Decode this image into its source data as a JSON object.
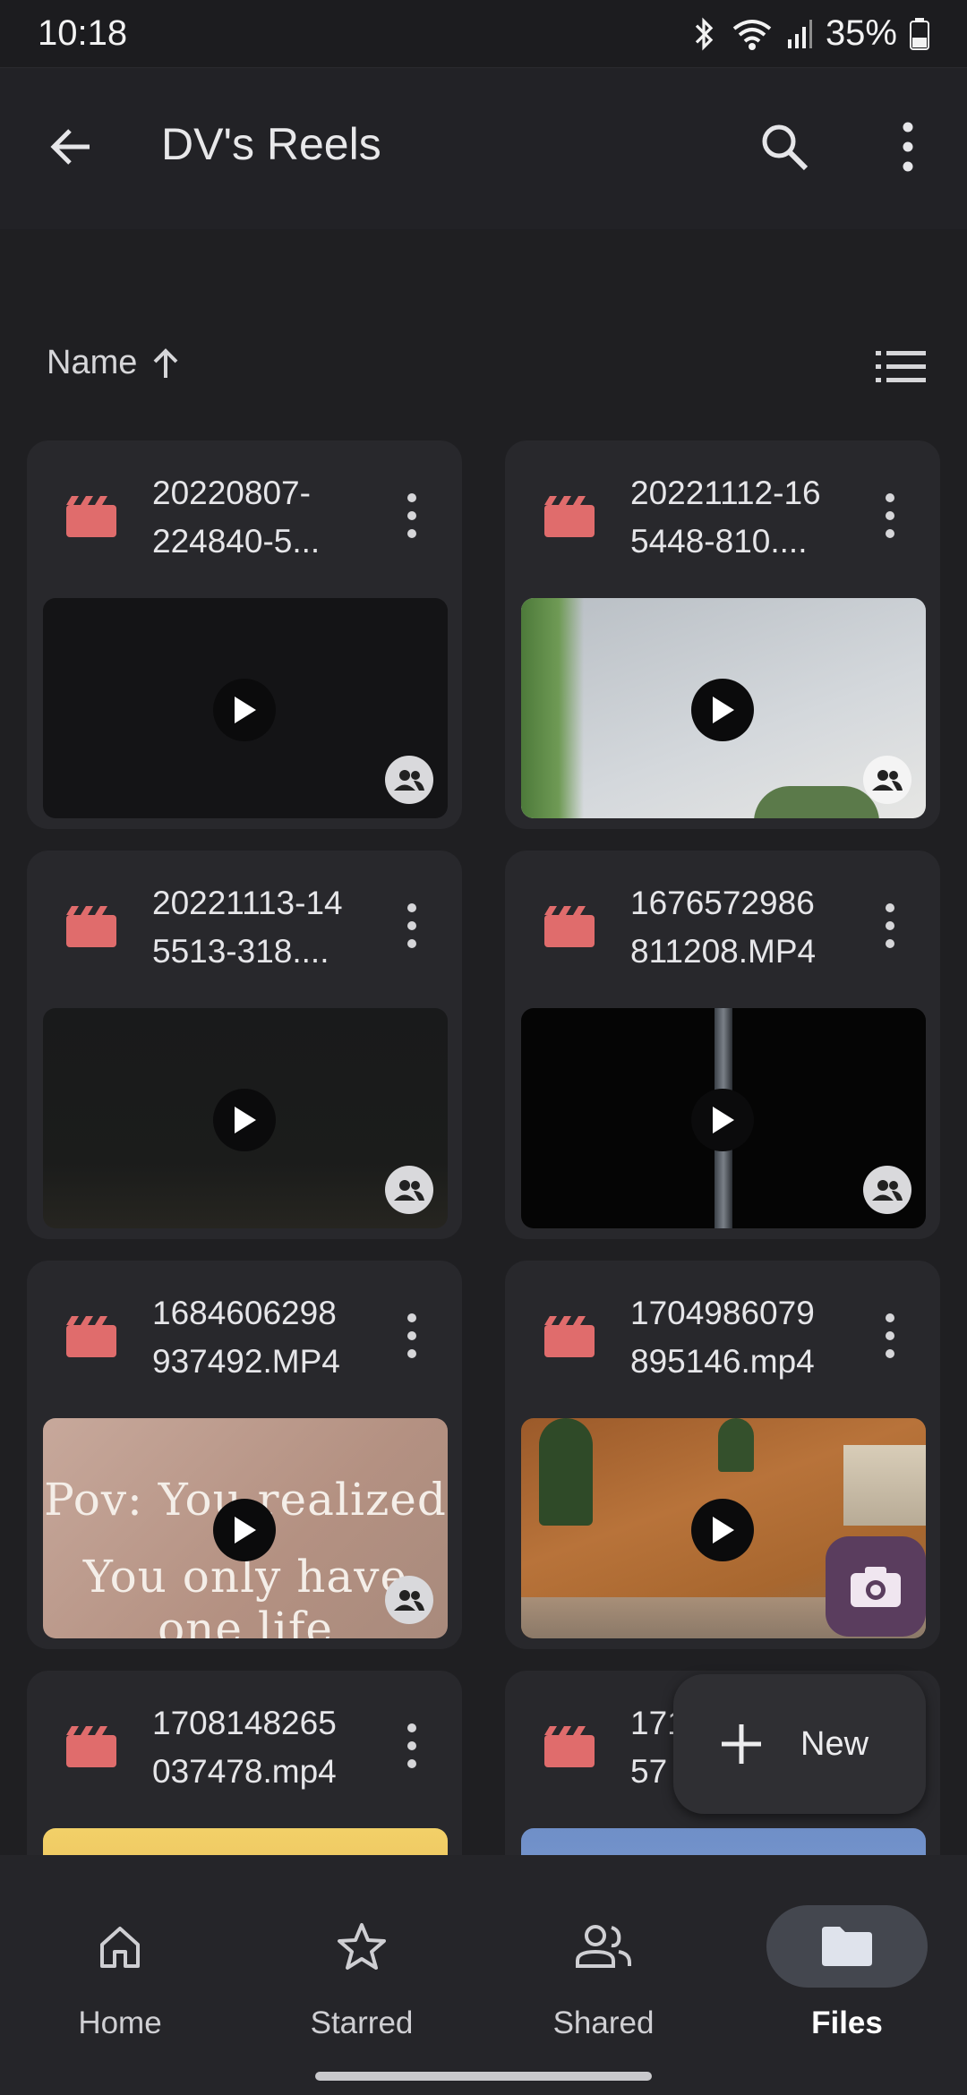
{
  "status_bar": {
    "time": "10:18",
    "battery": "35%"
  },
  "app_bar": {
    "title": "DV's Reels"
  },
  "sort": {
    "label": "Name",
    "direction_icon": "arrow-up-icon"
  },
  "files": [
    {
      "name": "20220807-\n224840-5...",
      "thumb": "dark"
    },
    {
      "name": "20221112-16\n5448-810....",
      "thumb": "sky"
    },
    {
      "name": "20221113-14\n5513-318....",
      "thumb": "dark2"
    },
    {
      "name": "1676572986\n811208.MP4",
      "thumb": "black"
    },
    {
      "name": "1684606298\n937492.MP4",
      "thumb": "pink",
      "thumb_text_line1": "Pov: You realized",
      "thumb_text_line2": "You only have one life"
    },
    {
      "name": "1704986079\n895146.mp4",
      "thumb": "hill"
    },
    {
      "name": "1708148265\n037478.mp4",
      "thumb": "yellow"
    },
    {
      "name": "171\n57",
      "thumb": "blue"
    }
  ],
  "fab": {
    "new_label": "New"
  },
  "nav": [
    {
      "label": "Home",
      "icon": "home-icon"
    },
    {
      "label": "Starred",
      "icon": "star-icon"
    },
    {
      "label": "Shared",
      "icon": "people-icon"
    },
    {
      "label": "Files",
      "icon": "folder-icon",
      "active": true
    }
  ],
  "colors": {
    "accent_file": "#e06c6c",
    "fab_camera": "#5a3d5e",
    "nav_active_pill": "#44474f"
  }
}
